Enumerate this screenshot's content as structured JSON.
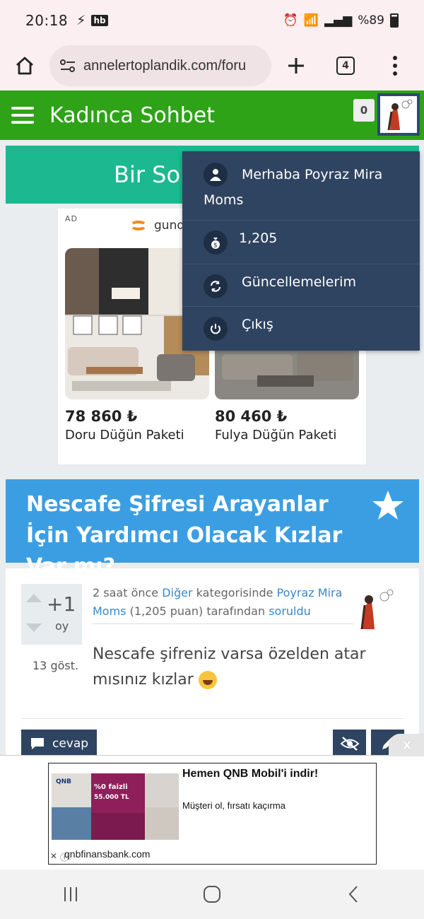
{
  "status_bar": {
    "time": "20:18",
    "carrier_badge": "hb",
    "battery": "%89"
  },
  "browser": {
    "url": "annelertoplandik.com/foru",
    "tab_count": "4"
  },
  "site": {
    "title": "Kadınca Sohbet",
    "notification_count": "0",
    "colors": {
      "header": "#2ea318",
      "dropdown": "#2f4461",
      "ask": "#1cb890",
      "question": "#3b9ee3"
    }
  },
  "ask_banner": {
    "label": "Bir Soru"
  },
  "user_menu": {
    "greeting": "Merhaba Poyraz Mira",
    "greeting_line2": "Moms",
    "points": "1,205",
    "updates": "Güncellemelerim",
    "logout": "Çıkış"
  },
  "ad": {
    "label": "AD",
    "brand": "gund",
    "products": [
      {
        "price": "78 860 ₺",
        "name": "Doru Düğün Paketi"
      },
      {
        "price": "80 460 ₺",
        "name": "Fulya Düğün Paketi"
      }
    ]
  },
  "question": {
    "title": "Nescafe Şifresi Arayanlar İçin Yardımcı Olacak Kızlar Var mı?",
    "votes": "+1",
    "vote_unit": "oy",
    "views": "13 göst.",
    "meta": {
      "time": "2 saat önce",
      "category": "Diğer",
      "category_suffix": "kategorisinde",
      "author": "Poyraz Mira Moms",
      "points": "(1,205 puan)",
      "by": "tarafından",
      "action": "soruldu"
    },
    "body": "Nescafe şifreniz varsa özelden atar mısınız kızlar",
    "answer_button": "cevap"
  },
  "bottom_ad": {
    "close": "X",
    "headline": "Hemen QNB Mobil'i indir!",
    "subtext": "Müşteri ol, fırsatı kaçırma",
    "domain": "qnbfinansbank.com",
    "image_text": {
      "brand": "QNB",
      "rate": "%0 faizli",
      "amount": "55.000 TL"
    }
  }
}
